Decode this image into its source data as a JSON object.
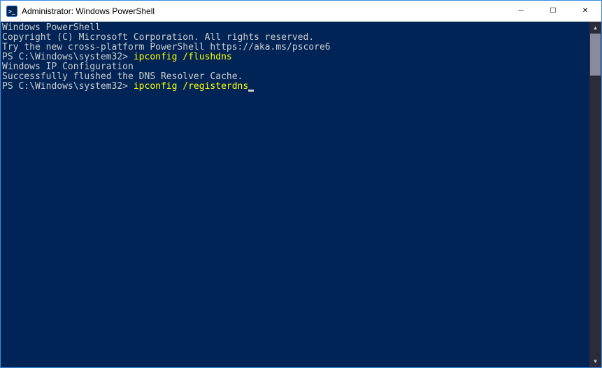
{
  "window": {
    "title": "Administrator: Windows PowerShell"
  },
  "controls": {
    "minimize": "─",
    "maximize": "☐",
    "close": "✕"
  },
  "terminal": {
    "lines": {
      "header1": "Windows PowerShell",
      "header2": "Copyright (C) Microsoft Corporation. All rights reserved.",
      "blank1": "",
      "pscore": "Try the new cross-platform PowerShell https://aka.ms/pscore6",
      "blank2": "",
      "prompt1_prefix": "PS C:\\Windows\\system32> ",
      "prompt1_cmd": "ipconfig /flushdns",
      "blank3": "",
      "ipconfig_title": "Windows IP Configuration",
      "blank4": "",
      "success": "Successfully flushed the DNS Resolver Cache.",
      "prompt2_prefix": "PS C:\\Windows\\system32> ",
      "prompt2_cmd": "ipconfig /registerdns"
    }
  },
  "scrollbar": {
    "up": "▲",
    "down": "▼"
  }
}
